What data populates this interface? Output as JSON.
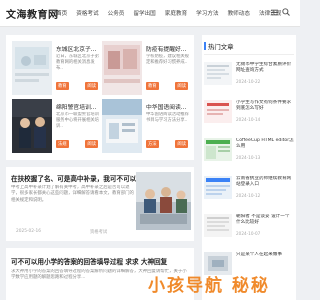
{
  "header": {
    "logo": "文海教育网",
    "nav": [
      "首页",
      "资格考试",
      "公务员",
      "留学出国",
      "家庭教育",
      "学习方法",
      "教师动态",
      "法律法规"
    ]
  },
  "cards": [
    {
      "title": "东城区北京子...",
      "desc": "近日，东城区北京子弟教育网的相关消息发布..",
      "badge": "教育",
      "tag": "阅读"
    },
    {
      "title": "防疫有提醒好...",
      "desc": "学校防疫，建议相关规定和推荐好习惯养成..",
      "badge": "教育",
      "tag": "阅读"
    },
    {
      "title": "绵阳警官培训...",
      "desc": "北京市一联盟警官培训服务中心将开展相关培训..",
      "badge": "法规",
      "tag": "阅读"
    },
    {
      "title": "中华国语阅读...",
      "desc": "中华国语阅读活动推荐书目与学习方法分享..",
      "badge": "方法",
      "tag": "阅读"
    }
  ],
  "feature": {
    "title": "在扶校握了名、可是高中补录，我可不可以退...",
    "desc": "中考上高中补录计划了解有关中考，高中补录之后是否可以退学，很多家长都关心这些问题，详细解答请看本文，教育部门的相关规定和说明。",
    "date": "2025-02-16",
    "category": "资格考试"
  },
  "article2": {
    "title": "可不可以用小学的答案的回答填导过程 求求 大神回复",
    "desc": "求大神用小学的答案的回答填导过程的答案解析问题的详细解答，大神回复请帮忙，关于小学数学应用题的解题思路和过程分享..."
  },
  "sidebar": {
    "heading": "热门文章",
    "items": [
      {
        "title": "无锡市中学生综合素质评价网址查询方式",
        "date": "2024-10-22"
      },
      {
        "title": "小学生写作文有何条件要求到底怎么写好",
        "date": "2024-10-14"
      },
      {
        "title": "CoffeeCup HTML editor怎么用",
        "date": "2024-10-13"
      },
      {
        "title": "云南省执业药师继续教育网站登录入口",
        "date": "2024-10-12"
      },
      {
        "title": "朝阳者 不是谈妥 设计一个什么比较好",
        "date": "2024-10-07"
      },
      {
        "title": "只是某个人在起来做事",
        "date": ""
      }
    ]
  },
  "watermark": {
    "text": "小孩导航 秘秘"
  },
  "colors": {
    "accent": "#f0743a",
    "link": "#3b82f6",
    "watermark": "#f08a2b"
  }
}
